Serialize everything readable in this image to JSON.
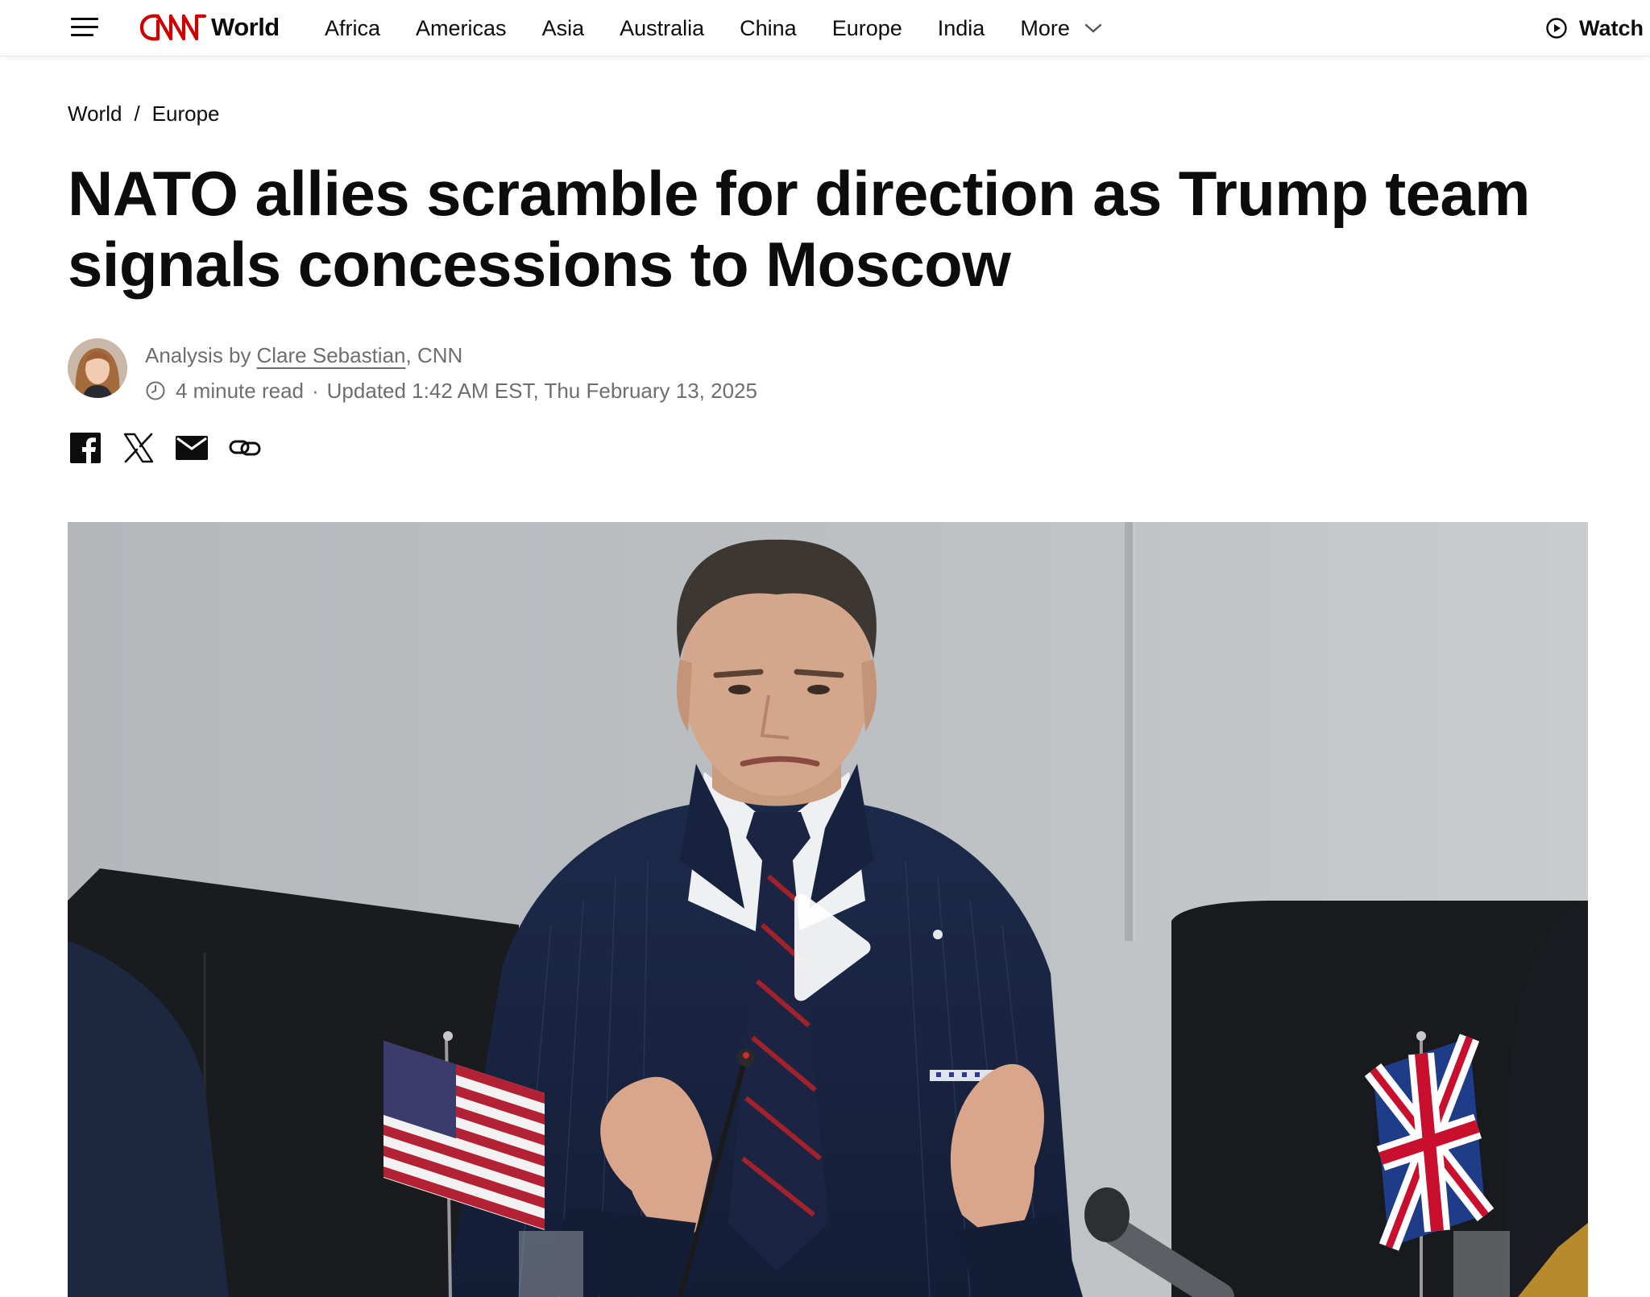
{
  "nav": {
    "brand": "CNN",
    "section": "World",
    "links": [
      "Africa",
      "Americas",
      "Asia",
      "Australia",
      "China",
      "Europe",
      "India"
    ],
    "more_label": "More",
    "watch_label": "Watch",
    "brand_color": "#cc0000"
  },
  "breadcrumb": {
    "items": [
      "World",
      "Europe"
    ],
    "separator": "/"
  },
  "article": {
    "headline": "NATO allies scramble for direction as Trump team signals concessions to Moscow",
    "byline_prefix": "Analysis by",
    "author": "Clare Sebastian",
    "outlet": ", CNN",
    "read_time": "4 minute read",
    "separator": "·",
    "updated": "Updated 1:42 AM EST, Thu February 13, 2025"
  },
  "share": {
    "icons": [
      "facebook-icon",
      "x-icon",
      "email-icon",
      "link-icon"
    ]
  },
  "hero": {
    "type": "video",
    "play_icon": "play-icon"
  }
}
